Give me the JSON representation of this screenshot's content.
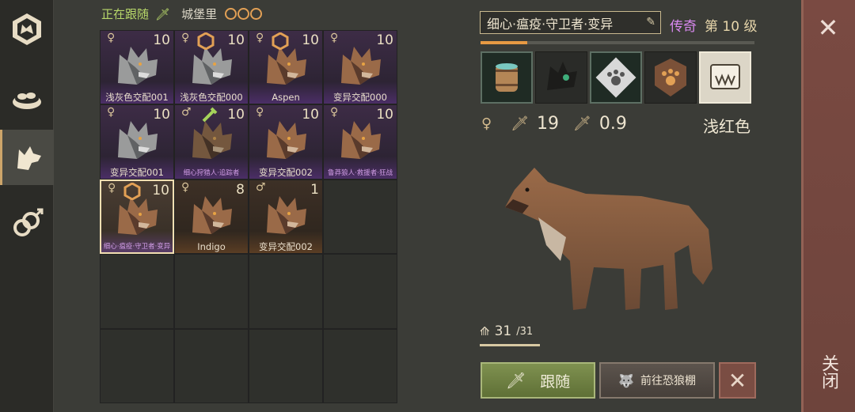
{
  "sidebar": {
    "tabs": [
      {
        "name": "wolf-emblem",
        "active": false
      },
      {
        "name": "food-bowl",
        "active": false
      },
      {
        "name": "wolf-pack",
        "active": true
      },
      {
        "name": "breeding",
        "active": false
      }
    ]
  },
  "header": {
    "status": "正在跟随",
    "location": "城堡里"
  },
  "wolves": [
    {
      "name": "浅灰色交配001",
      "level": "10",
      "sex": "♀",
      "style": "filled",
      "fur": "gray",
      "badge": ""
    },
    {
      "name": "浅灰色交配000",
      "level": "10",
      "sex": "♀",
      "style": "filled",
      "fur": "gray",
      "badge": "hex"
    },
    {
      "name": "Aspen",
      "level": "10",
      "sex": "♀",
      "style": "filled",
      "fur": "brown",
      "badge": "hex"
    },
    {
      "name": "变异交配000",
      "level": "10",
      "sex": "♀",
      "style": "filled",
      "fur": "brown",
      "badge": ""
    },
    {
      "name": "变异交配001",
      "level": "10",
      "sex": "♀",
      "style": "filled",
      "fur": "gray",
      "badge": ""
    },
    {
      "name": "细心狩猎人·追踪者",
      "level": "10",
      "sex": "♂",
      "style": "filled dim",
      "fur": "brown",
      "badge": "bone",
      "small": true
    },
    {
      "name": "变异交配002",
      "level": "10",
      "sex": "♀",
      "style": "filled",
      "fur": "brown",
      "badge": ""
    },
    {
      "name": "鲁莽狼人·救援者·狂战",
      "level": "10",
      "sex": "♀",
      "style": "filled",
      "fur": "brown",
      "badge": "",
      "small": true
    },
    {
      "name": "细心·瘟疫·守卫者·变异",
      "level": "10",
      "sex": "♀",
      "style": "selected",
      "fur": "brown",
      "badge": "hex",
      "small": true
    },
    {
      "name": "Indigo",
      "level": "8",
      "sex": "♀",
      "style": "rare",
      "fur": "brown",
      "badge": ""
    },
    {
      "name": "变异交配002",
      "level": "1",
      "sex": "♂",
      "style": "rare",
      "fur": "brown",
      "badge": ""
    }
  ],
  "details": {
    "title": "细心·瘟疫·守卫者·变异",
    "rarity": "传奇",
    "level": "第 10 级",
    "xp_fraction": 0.17,
    "attack": "19",
    "attack_speed": "0.9",
    "coat_color": "浅红色",
    "hp": "31",
    "hp_max": "/31"
  },
  "skills": [
    {
      "icon": "water-barrel-icon",
      "style": "passive"
    },
    {
      "icon": "toxic-wolf-icon",
      "style": "plain"
    },
    {
      "icon": "paw-badge-icon",
      "style": "passive"
    },
    {
      "icon": "paw-shield-icon",
      "style": "plain"
    },
    {
      "icon": "fang-scroll-icon",
      "style": "active"
    }
  ],
  "buttons": {
    "follow": "跟随",
    "go_den": "前往恐狼棚",
    "close": "关闭"
  },
  "colors": {
    "legendary": "#d989f0",
    "follow_green": "#7f9150",
    "close_red": "#7a4a42"
  }
}
